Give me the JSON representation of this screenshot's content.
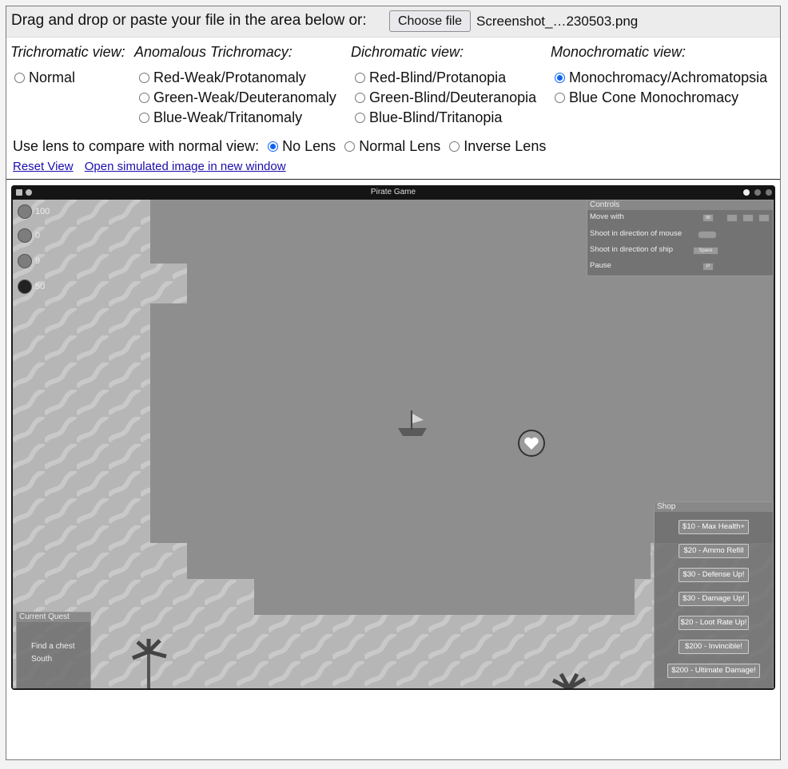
{
  "upload": {
    "prompt": "Drag and drop or paste your file in the area below or:",
    "button_label": "Choose file",
    "file_name": "Screenshot_…230503.png"
  },
  "columns": {
    "trichromatic": {
      "heading": "Trichromatic view:",
      "options": [
        "Normal"
      ]
    },
    "anomalous": {
      "heading": "Anomalous Trichromacy:",
      "options": [
        "Red-Weak/Protanomaly",
        "Green-Weak/Deuteranomaly",
        "Blue-Weak/Tritanomaly"
      ]
    },
    "dichromatic": {
      "heading": "Dichromatic view:",
      "options": [
        "Red-Blind/Protanopia",
        "Green-Blind/Deuteranopia",
        "Blue-Blind/Tritanopia"
      ]
    },
    "monochromatic": {
      "heading": "Monochromatic view:",
      "options": [
        "Monochromacy/Achromatopsia",
        "Blue Cone Monochromacy"
      ]
    },
    "selected": "Monochromacy/Achromatopsia"
  },
  "lens": {
    "label": "Use lens to compare with normal view:",
    "options": [
      "No Lens",
      "Normal Lens",
      "Inverse Lens"
    ],
    "selected": "No Lens"
  },
  "links": {
    "reset": "Reset View",
    "open_new": "Open simulated image in new window"
  },
  "game": {
    "window_title": "Pirate Game",
    "hud": {
      "health": "100",
      "stat2": "0",
      "stat3": "9",
      "ammo": "50"
    },
    "controls": {
      "title": "Controls",
      "rows": [
        "Move with",
        "Shoot in direction of mouse",
        "Shoot in direction of ship",
        "Pause"
      ],
      "keys": {
        "w": "W",
        "shoot_ship": "Space",
        "pause": "P"
      }
    },
    "quest": {
      "title": "Current Quest",
      "line1": "Find a chest",
      "line2": "South"
    },
    "shop": {
      "title": "Shop",
      "items": [
        "$10 - Max Health+",
        "$20 - Ammo Refill",
        "$30 - Defense Up!",
        "$30 - Damage Up!",
        "$20 - Loot Rate Up!",
        "$200 - Invincible!",
        "$200 - Ultimate Damage!"
      ]
    }
  },
  "colors": {
    "link": "#1a0dab",
    "radio_selected": "#0b63f6"
  }
}
